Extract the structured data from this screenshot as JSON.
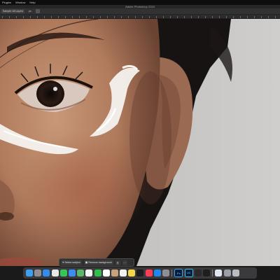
{
  "menubar": {
    "items": [
      "Plugins",
      "Window",
      "Help"
    ]
  },
  "window": {
    "title": "Adobe Photoshop 2024"
  },
  "options_bar": {
    "chip_label": "Sample: All Layers",
    "value_label": "px"
  },
  "contextual_task_bar": {
    "select_subject_label": "Select subject",
    "remove_background_label": "Remove background"
  },
  "dock": {
    "apps": [
      {
        "name": "finder-icon",
        "label": "",
        "color": "#3aa0f5"
      },
      {
        "name": "launchpad-icon",
        "label": "",
        "color": "#8e8e93"
      },
      {
        "name": "safari-icon",
        "label": "",
        "color": "#2f8cf0"
      },
      {
        "name": "chrome-icon",
        "label": "",
        "color": "#e8e8e8"
      },
      {
        "name": "messages-icon",
        "label": "",
        "color": "#34c759"
      },
      {
        "name": "mail-icon",
        "label": "",
        "color": "#3b8df1"
      },
      {
        "name": "maps-icon",
        "label": "",
        "color": "#58b867"
      },
      {
        "name": "photos-icon",
        "label": "",
        "color": "#f3f3f3"
      },
      {
        "name": "facetime-icon",
        "label": "",
        "color": "#2fbf4a"
      },
      {
        "name": "calendar-icon",
        "label": "",
        "color": "#ffffff"
      },
      {
        "name": "contacts-icon",
        "label": "",
        "color": "#c8a27a"
      },
      {
        "name": "reminders-icon",
        "label": "",
        "color": "#f2f2f2"
      },
      {
        "name": "notes-icon",
        "label": "",
        "color": "#f7d548"
      },
      {
        "name": "tv-icon",
        "label": "",
        "color": "#1c1c1e"
      },
      {
        "name": "music-icon",
        "label": "",
        "color": "#fa3c55"
      },
      {
        "name": "appstore-icon",
        "label": "",
        "color": "#1e88f0"
      },
      {
        "name": "settings-icon",
        "label": "",
        "color": "#8e8e93"
      },
      {
        "name": "photoshop-icon",
        "label": "Ps",
        "color": "#0a1a33"
      },
      {
        "name": "lightroom-icon",
        "label": "LrC",
        "color": "#0a1a33"
      },
      {
        "name": "finalcut-icon",
        "label": "",
        "color": "#2a2a2a"
      },
      {
        "name": "terminal-icon",
        "label": "",
        "color": "#1e1e1e"
      },
      {
        "name": "preview-icon",
        "label": "",
        "color": "#dfe6ee"
      },
      {
        "name": "files-icon",
        "label": "",
        "color": "#9aa0a6"
      },
      {
        "name": "trash-icon",
        "label": "",
        "color": "#b9bcc0"
      }
    ]
  },
  "colors": {
    "background_wall": "#c6c5c3",
    "skin": "#b8876a",
    "paint": "#f4f2ee"
  }
}
